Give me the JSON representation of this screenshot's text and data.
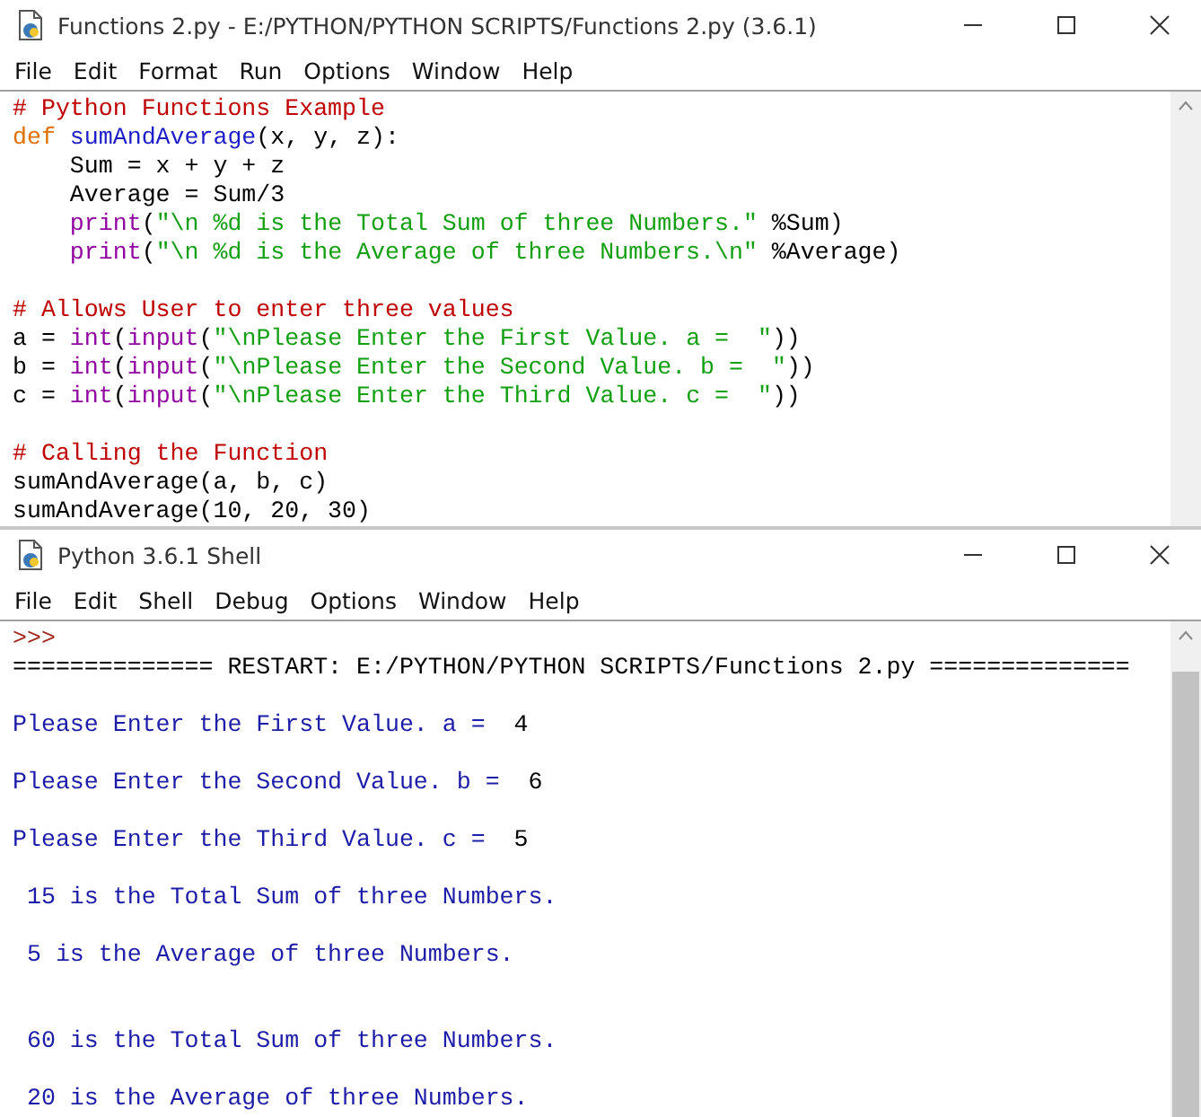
{
  "editor": {
    "title": "Functions 2.py - E:/PYTHON/PYTHON SCRIPTS/Functions 2.py (3.6.1)",
    "menu": [
      "File",
      "Edit",
      "Format",
      "Run",
      "Options",
      "Window",
      "Help"
    ],
    "lines": [
      {
        "kind": "code",
        "tokens": [
          {
            "kind": "comment",
            "text": "# Python Functions Example"
          }
        ]
      },
      {
        "kind": "code",
        "tokens": [
          {
            "kind": "keyword",
            "text": "def"
          },
          {
            "kind": "defname",
            "text": " sumAndAverage"
          },
          {
            "kind": "plain",
            "text": "(x, y, z):"
          }
        ]
      },
      {
        "kind": "code",
        "tokens": [
          {
            "kind": "plain",
            "text": "    Sum = x + y + z"
          }
        ]
      },
      {
        "kind": "code",
        "tokens": [
          {
            "kind": "plain",
            "text": "    Average = Sum/3"
          }
        ]
      },
      {
        "kind": "code",
        "tokens": [
          {
            "kind": "builtin",
            "text": "    print"
          },
          {
            "kind": "plain",
            "text": "("
          },
          {
            "kind": "string",
            "text": "\"\\n %d is the Total Sum of three Numbers.\""
          },
          {
            "kind": "plain",
            "text": " %Sum)"
          }
        ]
      },
      {
        "kind": "code",
        "tokens": [
          {
            "kind": "builtin",
            "text": "    print"
          },
          {
            "kind": "plain",
            "text": "("
          },
          {
            "kind": "string",
            "text": "\"\\n %d is the Average of three Numbers.\\n\""
          },
          {
            "kind": "plain",
            "text": " %Average)"
          }
        ]
      },
      {
        "kind": "blank"
      },
      {
        "kind": "code",
        "tokens": [
          {
            "kind": "comment",
            "text": "# Allows User to enter three values"
          }
        ]
      },
      {
        "kind": "code",
        "tokens": [
          {
            "kind": "plain",
            "text": "a = "
          },
          {
            "kind": "builtin",
            "text": "int"
          },
          {
            "kind": "plain",
            "text": "("
          },
          {
            "kind": "builtin",
            "text": "input"
          },
          {
            "kind": "plain",
            "text": "("
          },
          {
            "kind": "string",
            "text": "\"\\nPlease Enter the First Value. a =  \""
          },
          {
            "kind": "plain",
            "text": "))"
          }
        ]
      },
      {
        "kind": "code",
        "tokens": [
          {
            "kind": "plain",
            "text": "b = "
          },
          {
            "kind": "builtin",
            "text": "int"
          },
          {
            "kind": "plain",
            "text": "("
          },
          {
            "kind": "builtin",
            "text": "input"
          },
          {
            "kind": "plain",
            "text": "("
          },
          {
            "kind": "string",
            "text": "\"\\nPlease Enter the Second Value. b =  \""
          },
          {
            "kind": "plain",
            "text": "))"
          }
        ]
      },
      {
        "kind": "code",
        "tokens": [
          {
            "kind": "plain",
            "text": "c = "
          },
          {
            "kind": "builtin",
            "text": "int"
          },
          {
            "kind": "plain",
            "text": "("
          },
          {
            "kind": "builtin",
            "text": "input"
          },
          {
            "kind": "plain",
            "text": "("
          },
          {
            "kind": "string",
            "text": "\"\\nPlease Enter the Third Value. c =  \""
          },
          {
            "kind": "plain",
            "text": "))"
          }
        ]
      },
      {
        "kind": "blank"
      },
      {
        "kind": "code",
        "tokens": [
          {
            "kind": "comment",
            "text": "# Calling the Function"
          }
        ]
      },
      {
        "kind": "code",
        "tokens": [
          {
            "kind": "plain",
            "text": "sumAndAverage(a, b, c)"
          }
        ]
      },
      {
        "kind": "code",
        "tokens": [
          {
            "kind": "plain",
            "text": "sumAndAverage(10, 20, 30)"
          }
        ]
      }
    ]
  },
  "shell": {
    "title": "Python 3.6.1 Shell",
    "menu": [
      "File",
      "Edit",
      "Shell",
      "Debug",
      "Options",
      "Window",
      "Help"
    ],
    "lines": [
      {
        "kind": "code",
        "tokens": [
          {
            "kind": "prompt",
            "text": ">>>"
          }
        ]
      },
      {
        "kind": "code",
        "tokens": [
          {
            "kind": "plain",
            "text": "============== RESTART: E:/PYTHON/PYTHON SCRIPTS/Functions 2.py =============="
          }
        ]
      },
      {
        "kind": "blank"
      },
      {
        "kind": "code",
        "tokens": [
          {
            "kind": "output",
            "text": "Please Enter the First Value. a =  "
          },
          {
            "kind": "input",
            "text": "4"
          }
        ]
      },
      {
        "kind": "blank"
      },
      {
        "kind": "code",
        "tokens": [
          {
            "kind": "output",
            "text": "Please Enter the Second Value. b =  "
          },
          {
            "kind": "input",
            "text": "6"
          }
        ]
      },
      {
        "kind": "blank"
      },
      {
        "kind": "code",
        "tokens": [
          {
            "kind": "output",
            "text": "Please Enter the Third Value. c =  "
          },
          {
            "kind": "input",
            "text": "5"
          }
        ]
      },
      {
        "kind": "blank"
      },
      {
        "kind": "code",
        "tokens": [
          {
            "kind": "output",
            "text": " 15 is the Total Sum of three Numbers."
          }
        ]
      },
      {
        "kind": "blank"
      },
      {
        "kind": "code",
        "tokens": [
          {
            "kind": "output",
            "text": " 5 is the Average of three Numbers."
          }
        ]
      },
      {
        "kind": "blank"
      },
      {
        "kind": "blank"
      },
      {
        "kind": "code",
        "tokens": [
          {
            "kind": "output",
            "text": " 60 is the Total Sum of three Numbers."
          }
        ]
      },
      {
        "kind": "blank"
      },
      {
        "kind": "code",
        "tokens": [
          {
            "kind": "output",
            "text": " 20 is the Average of three Numbers."
          }
        ]
      }
    ]
  }
}
